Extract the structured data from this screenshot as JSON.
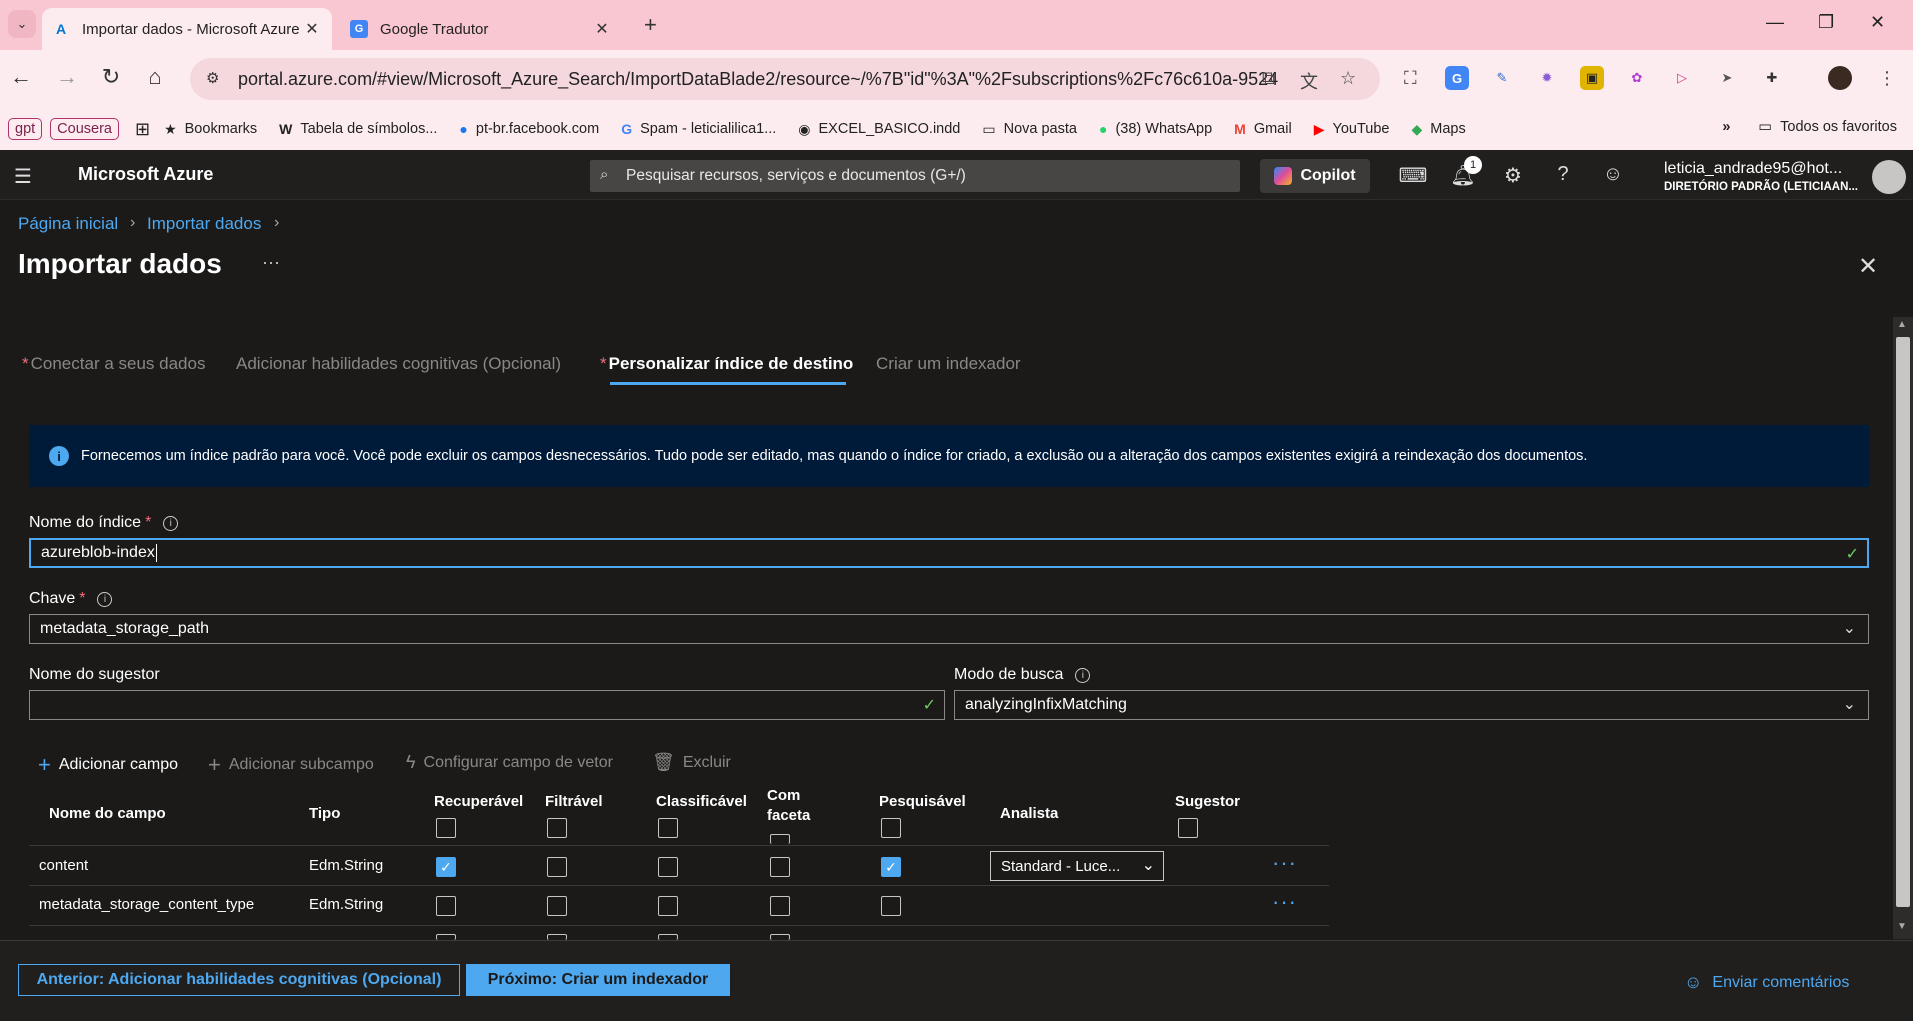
{
  "browser": {
    "tabs": [
      {
        "title": "Importar dados - Microsoft Azure",
        "favicon": "azure-icon"
      },
      {
        "title": "Google Tradutor",
        "favicon": "google-translate-icon"
      }
    ],
    "url": "portal.azure.com/#view/Microsoft_Azure_Search/ImportDataBlade2/resource~/%7B\"id\"%3A\"%2Fsubscriptions%2Fc76c610a-9524...",
    "bookmarks": [
      "gpt",
      "Cousera",
      "Bookmarks",
      "Tabela de símbolos...",
      "pt-br.facebook.com",
      "Spam - leticialilica1...",
      "EXCEL_BASICO.indd",
      "Nova pasta",
      "(38) WhatsApp",
      "Gmail",
      "YouTube",
      "Maps"
    ],
    "all_bookmarks": "Todos os favoritos"
  },
  "azure": {
    "brand": "Microsoft Azure",
    "search_placeholder": "Pesquisar recursos, serviços e documentos (G+/)",
    "copilot": "Copilot",
    "notif_count": "1",
    "user_email": "leticia_andrade95@hot...",
    "user_dir": "DIRETÓRIO PADRÃO (LETICIAAN..."
  },
  "blade": {
    "breadcrumb": [
      "Página inicial",
      "Importar dados"
    ],
    "title": "Importar dados",
    "steps": [
      "Conectar a seus dados",
      "Adicionar habilidades cognitivas (Opcional)",
      "Personalizar índice de destino",
      "Criar um indexador"
    ],
    "info": "Fornecemos um índice padrão para você. Você pode excluir os campos desnecessários. Tudo pode ser editado, mas quando o índice for criado, a exclusão ou a alteração dos campos existentes exigirá a reindexação dos documentos.",
    "index_name_label": "Nome do índice",
    "index_name_value": "azureblob-index",
    "key_label": "Chave",
    "key_value": "metadata_storage_path",
    "suggester_label": "Nome do sugestor",
    "suggester_value": "",
    "search_mode_label": "Modo de busca",
    "search_mode_value": "analyzingInfixMatching",
    "toolbar": {
      "add_field": "Adicionar campo",
      "add_subfield": "Adicionar subcampo",
      "vector": "Configurar campo de vetor",
      "delete": "Excluir"
    },
    "table": {
      "headers": [
        "Nome do campo",
        "Tipo",
        "Recuperável",
        "Filtrável",
        "Classificável",
        "Com faceta",
        "Pesquisável",
        "Analista",
        "Sugestor"
      ],
      "rows": [
        {
          "name": "content",
          "type": "Edm.String",
          "retrievable": true,
          "filterable": false,
          "sortable": false,
          "facetable": false,
          "searchable": true,
          "analyzer": "Standard - Luce..."
        },
        {
          "name": "metadata_storage_content_type",
          "type": "Edm.String",
          "retrievable": false,
          "filterable": false,
          "sortable": false,
          "facetable": false,
          "searchable": false,
          "analyzer": ""
        }
      ]
    },
    "footer": {
      "prev": "Anterior: Adicionar habilidades cognitivas (Opcional)",
      "next": "Próximo: Criar um indexador",
      "feedback": "Enviar comentários"
    }
  }
}
